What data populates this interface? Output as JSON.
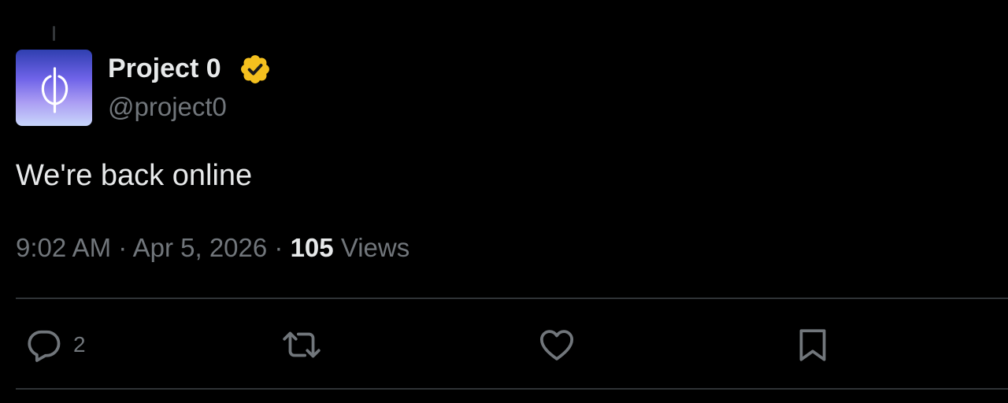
{
  "tweet": {
    "author": {
      "display_name": "Project 0",
      "handle": "@project0",
      "verified": true,
      "verified_color": "#f4c01e",
      "avatar_icon": "project0-logo"
    },
    "text": "We're back online",
    "time": "9:02 AM",
    "date": "Apr 5, 2026",
    "separator": "·",
    "views_count": "105",
    "views_label": "Views"
  },
  "actions": {
    "reply": {
      "icon": "reply-icon",
      "count": "2"
    },
    "retweet": {
      "icon": "retweet-icon"
    },
    "like": {
      "icon": "heart-icon"
    },
    "bookmark": {
      "icon": "bookmark-icon"
    }
  },
  "colors": {
    "background": "#000000",
    "primary_text": "#e7e9ea",
    "secondary_text": "#71767b",
    "divider": "#2f3336"
  }
}
